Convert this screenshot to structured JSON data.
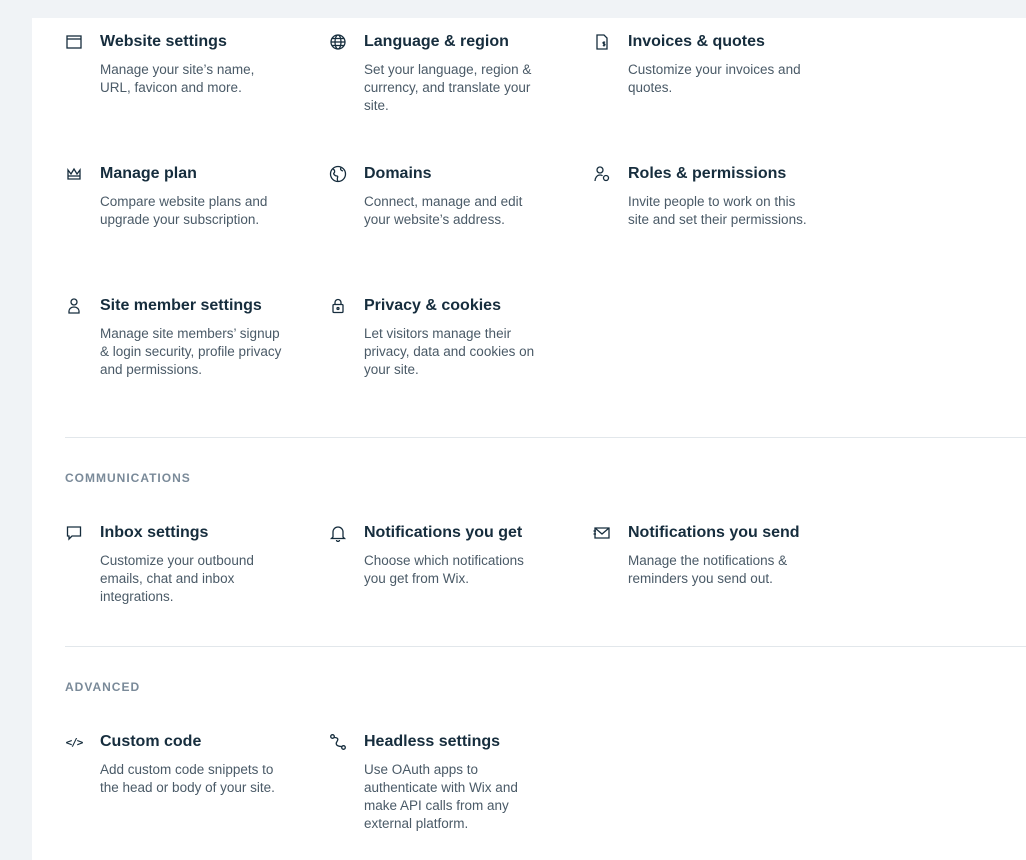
{
  "general": {
    "items": [
      {
        "icon": "browser-window-icon",
        "title": "Website settings",
        "desc": "Manage your site’s name, URL, favicon and more."
      },
      {
        "icon": "globe-icon",
        "title": "Language & region",
        "desc": "Set your language, region & currency, and translate your site."
      },
      {
        "icon": "invoice-icon",
        "title": "Invoices & quotes",
        "desc": "Customize your invoices and quotes."
      },
      {
        "icon": "crown-icon",
        "title": "Manage plan",
        "desc": "Compare website plans and upgrade your subscription."
      },
      {
        "icon": "domain-globe-icon",
        "title": "Domains",
        "desc": "Connect, manage and edit your website’s address."
      },
      {
        "icon": "user-settings-icon",
        "title": "Roles & permissions",
        "desc": "Invite people to work on this site and set their permissions."
      },
      {
        "icon": "person-icon",
        "title": "Site member settings",
        "desc": "Manage site members’ signup & login security, profile privacy and permissions."
      },
      {
        "icon": "lock-icon",
        "title": "Privacy & cookies",
        "desc": "Let visitors manage their privacy, data and cookies on your site."
      }
    ]
  },
  "communications": {
    "heading": "COMMUNICATIONS",
    "items": [
      {
        "icon": "chat-bubble-icon",
        "title": "Inbox settings",
        "desc": "Customize your outbound emails, chat and inbox integrations."
      },
      {
        "icon": "bell-icon",
        "title": "Notifications you get",
        "desc": "Choose which notifications you get from Wix."
      },
      {
        "icon": "envelope-send-icon",
        "title": "Notifications you send",
        "desc": "Manage the notifications & reminders you send out."
      }
    ]
  },
  "advanced": {
    "heading": "ADVANCED",
    "items": [
      {
        "icon": "code-icon",
        "title": "Custom code",
        "desc": "Add custom code snippets to the head or body of your site."
      },
      {
        "icon": "headless-icon",
        "title": "Headless settings",
        "desc": "Use OAuth apps to authenticate with Wix and make API calls from any external platform."
      }
    ]
  },
  "code_icon_text": "</>"
}
